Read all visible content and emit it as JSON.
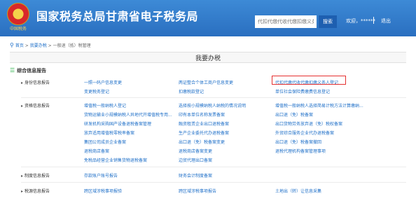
{
  "header": {
    "emblem_caption": "中国税务",
    "site_title": "国家税务总局甘肃省电子税务局",
    "search_placeholder": "代扣代缴代收代缴扣缴义务人登记",
    "search_button": "搜索",
    "user_name": "欢迎，******",
    "logout": "退出"
  },
  "breadcrumb": {
    "home": "首页",
    "sep1": " > ",
    "level2": "我要办税",
    "sep2": " > ",
    "current": "一般退（抵）税管理"
  },
  "page_title": "我要办税",
  "group_title": "综合信息报告",
  "sections": {
    "identity": {
      "label": "身份信息报告",
      "links": [
        "一照一码户信息变更",
        "两证整合个体工商户信息变更",
        "代扣代缴代收代缴扣缴义务人登记",
        "变更税务登记",
        "扣缴税款登记",
        "单位社会保险费缴费信息登记"
      ]
    },
    "qualification": {
      "label": "资格信息报告",
      "links": [
        "增值税一般纳税人登记",
        "选择按小规模纳税人纳税的情况说明",
        "增值税一般纳税人选择简易计税方法计算缴纳...",
        "货物运输业小规模纳税人异地代开增值税专用...",
        "印有本单位名称发票备案",
        "出口退（免）税备案",
        "研发机构采购国产设备退税备案管理",
        "融资租赁企业出口退税备案",
        "出口货物劳务放弃退（免）税权备案",
        "放弃适用增值税零税率备案",
        "生产企业委托代办退税备案",
        "外贸综合服务企业代办退税备案",
        "集团公司成员企业备案",
        "出口退（免）税备案变更",
        "出口退（免）税备案撤回",
        "退税商店备案",
        "退税商店备案变更",
        "退税代理机构备案管理事项",
        "免税品经营企业销售货物退税备案",
        "边贸代理出口备案"
      ]
    },
    "system": {
      "label": "制度信息报告",
      "links": [
        "存款账户账号报告",
        "财务会计制度备案"
      ]
    },
    "tax_pref": {
      "label": "税源信息报告",
      "links": [
        "跨区域涉税事项报验",
        "跨区域涉税事项报告",
        "土地出（转）让信息采集"
      ]
    }
  }
}
